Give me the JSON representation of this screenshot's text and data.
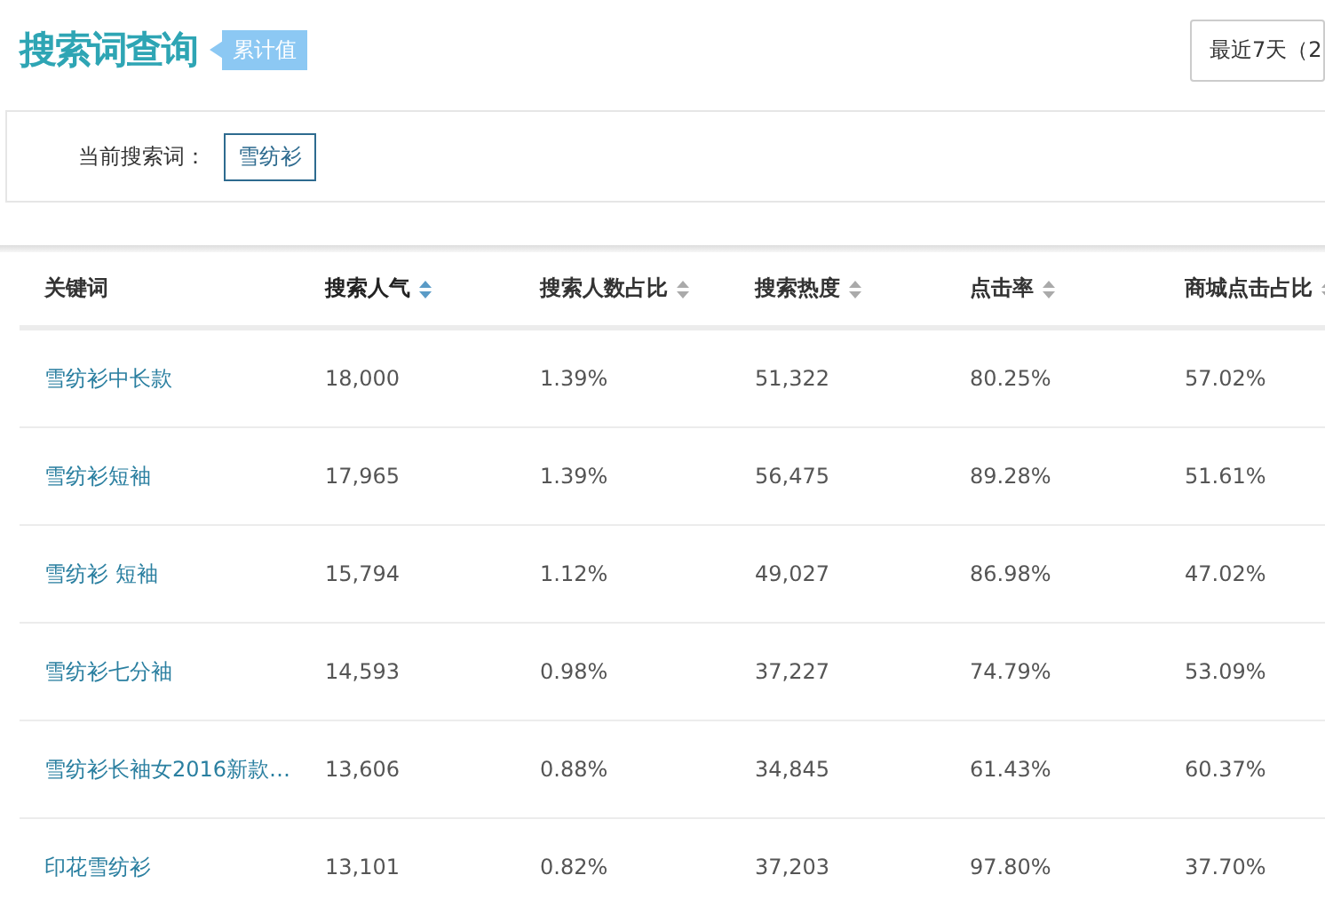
{
  "title": "搜索词查询",
  "badge": "累计值",
  "date_select": "最近7天（2",
  "current": {
    "label": "当前搜索词：",
    "term": "雪纺衫"
  },
  "columns": [
    {
      "label": "关键词"
    },
    {
      "label": "搜索人气",
      "selected": true
    },
    {
      "label": "搜索人数占比",
      "selected": false
    },
    {
      "label": "搜索热度",
      "selected": false
    },
    {
      "label": "点击率",
      "selected": false
    },
    {
      "label": "商城点击占比",
      "selected": false
    }
  ],
  "rows": [
    [
      "雪纺衫中长款",
      "18,000",
      "1.39%",
      "51,322",
      "80.25%",
      "57.02%"
    ],
    [
      "雪纺衫短袖",
      "17,965",
      "1.39%",
      "56,475",
      "89.28%",
      "51.61%"
    ],
    [
      "雪纺衫 短袖",
      "15,794",
      "1.12%",
      "49,027",
      "86.98%",
      "47.02%"
    ],
    [
      "雪纺衫七分袖",
      "14,593",
      "0.98%",
      "37,227",
      "74.79%",
      "53.09%"
    ],
    [
      "雪纺衫长袖女2016新款…",
      "13,606",
      "0.88%",
      "34,845",
      "61.43%",
      "60.37%"
    ],
    [
      "印花雪纺衫",
      "13,101",
      "0.82%",
      "37,203",
      "97.80%",
      "37.70%"
    ]
  ]
}
